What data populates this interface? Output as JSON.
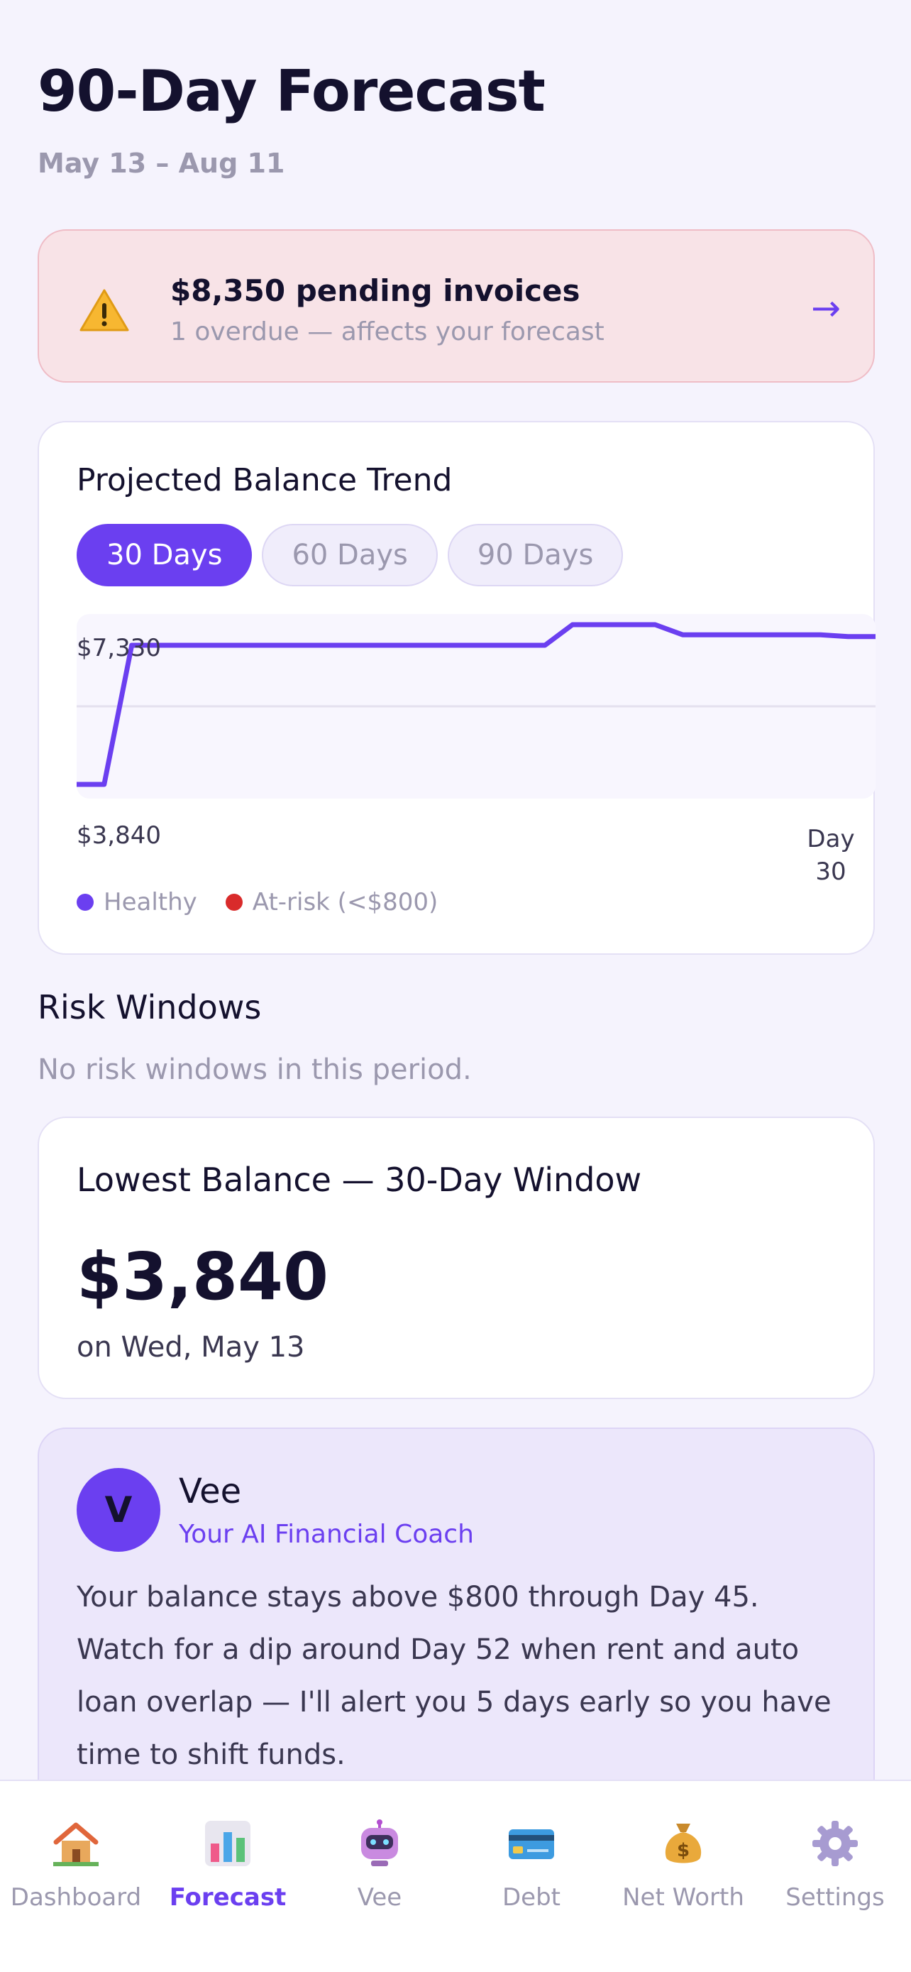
{
  "header": {
    "title": "90-Day Forecast",
    "date_range": "May 13 – Aug 11"
  },
  "alert": {
    "icon": "warning-icon",
    "title": "$8,350 pending invoices",
    "subtitle": "1 overdue — affects your forecast",
    "arrow": "→",
    "background": "#f8e3e7"
  },
  "trend_card": {
    "title": "Projected Balance Trend",
    "ranges": [
      {
        "label": "30 Days",
        "active": true
      },
      {
        "label": "60 Days",
        "active": false
      },
      {
        "label": "90 Days",
        "active": false
      }
    ],
    "max_label": "$7,330",
    "min_label": "$3,840",
    "x_end_label_line1": "Day",
    "x_end_label_line2": "30",
    "legend": [
      {
        "label": "Healthy",
        "color": "#6b3ff0"
      },
      {
        "label": "At-risk (<$800)",
        "color": "#d92b2b"
      }
    ]
  },
  "chart_data": {
    "type": "line",
    "x": [
      1,
      2,
      3,
      4,
      5,
      6,
      7,
      8,
      9,
      10,
      11,
      12,
      13,
      14,
      15,
      16,
      17,
      18,
      19,
      20,
      21,
      22,
      23,
      24,
      25,
      26,
      27,
      28,
      29,
      30
    ],
    "series": [
      {
        "values": [
          3840,
          3840,
          6880,
          6880,
          6880,
          6880,
          6880,
          6880,
          6880,
          6880,
          6880,
          6880,
          6880,
          6880,
          6880,
          6880,
          6880,
          6880,
          7330,
          7330,
          7330,
          7330,
          7110,
          7110,
          7110,
          7110,
          7110,
          7110,
          7070,
          7070
        ]
      }
    ],
    "ylim": [
      3840,
      7330
    ],
    "grid": true,
    "line_color": "#6b3ff0"
  },
  "risk": {
    "title": "Risk Windows",
    "empty_text": "No risk windows in this period."
  },
  "lowest": {
    "title": "Lowest Balance — 30-Day Window",
    "value": "$3,840",
    "date": "on Wed, May 13"
  },
  "coach": {
    "avatar_letter": "V",
    "name": "Vee",
    "role": "Your AI Financial Coach",
    "message": "Your balance stays above $800 through Day 45. Watch for a dip around Day 52 when rent and auto loan overlap — I'll alert you 5 days early so you have time to shift funds."
  },
  "tabs": [
    {
      "label": "Dashboard",
      "icon": "house-icon",
      "active": false
    },
    {
      "label": "Forecast",
      "icon": "bar-chart-icon",
      "active": true
    },
    {
      "label": "Vee",
      "icon": "robot-icon",
      "active": false
    },
    {
      "label": "Debt",
      "icon": "credit-card-icon",
      "active": false
    },
    {
      "label": "Net Worth",
      "icon": "money-bag-icon",
      "active": false
    },
    {
      "label": "Settings",
      "icon": "gear-icon",
      "active": false
    }
  ],
  "colors": {
    "accent": "#6b3ff0",
    "background": "#f5f3fd",
    "risk": "#d92b2b"
  }
}
